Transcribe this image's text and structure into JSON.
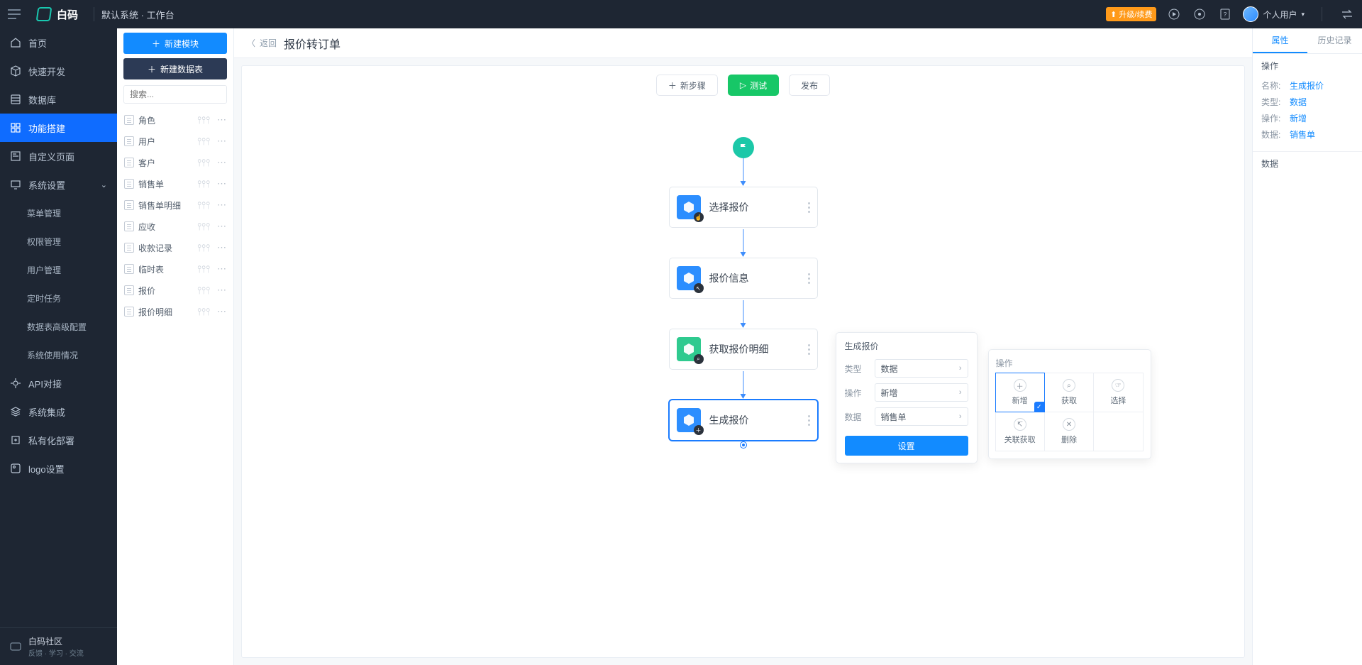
{
  "top": {
    "system_title": "默认系统 · 工作台",
    "brand": "白码",
    "upgrade": "升级/续费",
    "user_name": "个人用户"
  },
  "left_nav": {
    "items": [
      {
        "label": "首页",
        "icon": "home"
      },
      {
        "label": "快速开发",
        "icon": "cube"
      },
      {
        "label": "数据库",
        "icon": "db"
      },
      {
        "label": "功能搭建",
        "icon": "blocks",
        "active": true
      },
      {
        "label": "自定义页面",
        "icon": "page"
      },
      {
        "label": "系统设置",
        "icon": "monitor",
        "expandable": true
      }
    ],
    "sub_items": [
      "菜单管理",
      "权限管理",
      "用户管理",
      "定时任务",
      "数据表高级配置",
      "系统使用情况"
    ],
    "items2": [
      {
        "label": "API对接",
        "icon": "api"
      },
      {
        "label": "系统集成",
        "icon": "stack"
      },
      {
        "label": "私有化部署",
        "icon": "deploy"
      },
      {
        "label": "logo设置",
        "icon": "logo"
      }
    ],
    "footer": {
      "title": "白码社区",
      "sub": "反馈 · 学习 · 交流"
    }
  },
  "module_panel": {
    "btn_new_module": "新建模块",
    "btn_new_table": "新建数据表",
    "search_placeholder": "搜索...",
    "tables": [
      "角色",
      "用户",
      "客户",
      "销售单",
      "销售单明细",
      "应收",
      "收款记录",
      "临时表",
      "报价",
      "报价明细"
    ]
  },
  "main": {
    "back": "返回",
    "title": "报价转订单",
    "toolbar": {
      "new_step": "新步骤",
      "test": "测试",
      "publish": "发布"
    },
    "nodes": [
      {
        "label": "选择报价",
        "color": "blue",
        "badge": "hand"
      },
      {
        "label": "报价信息",
        "color": "blue",
        "badge": "arrow"
      },
      {
        "label": "获取报价明细",
        "color": "green",
        "badge": "search"
      },
      {
        "label": "生成报价",
        "color": "blue",
        "badge": "plus",
        "selected": true
      }
    ]
  },
  "popover": {
    "title": "生成报价",
    "rows": [
      {
        "label": "类型",
        "value": "数据"
      },
      {
        "label": "操作",
        "value": "新增"
      },
      {
        "label": "数据",
        "value": "销售单"
      }
    ],
    "set_btn": "设置"
  },
  "actions": {
    "title": "操作",
    "cells": [
      {
        "label": "新增",
        "icon": "＋",
        "selected": true
      },
      {
        "label": "获取",
        "icon": "⌕"
      },
      {
        "label": "选择",
        "icon": "☞"
      },
      {
        "label": "关联获取",
        "icon": "↸"
      },
      {
        "label": "删除",
        "icon": "✕"
      }
    ]
  },
  "right": {
    "tabs": [
      "属性",
      "历史记录"
    ],
    "section_ops": "操作",
    "props": [
      {
        "label": "名称:",
        "value": "生成报价"
      },
      {
        "label": "类型:",
        "value": "数据"
      },
      {
        "label": "操作:",
        "value": "新增"
      },
      {
        "label": "数据:",
        "value": "销售单"
      }
    ],
    "section_data": "数据"
  }
}
